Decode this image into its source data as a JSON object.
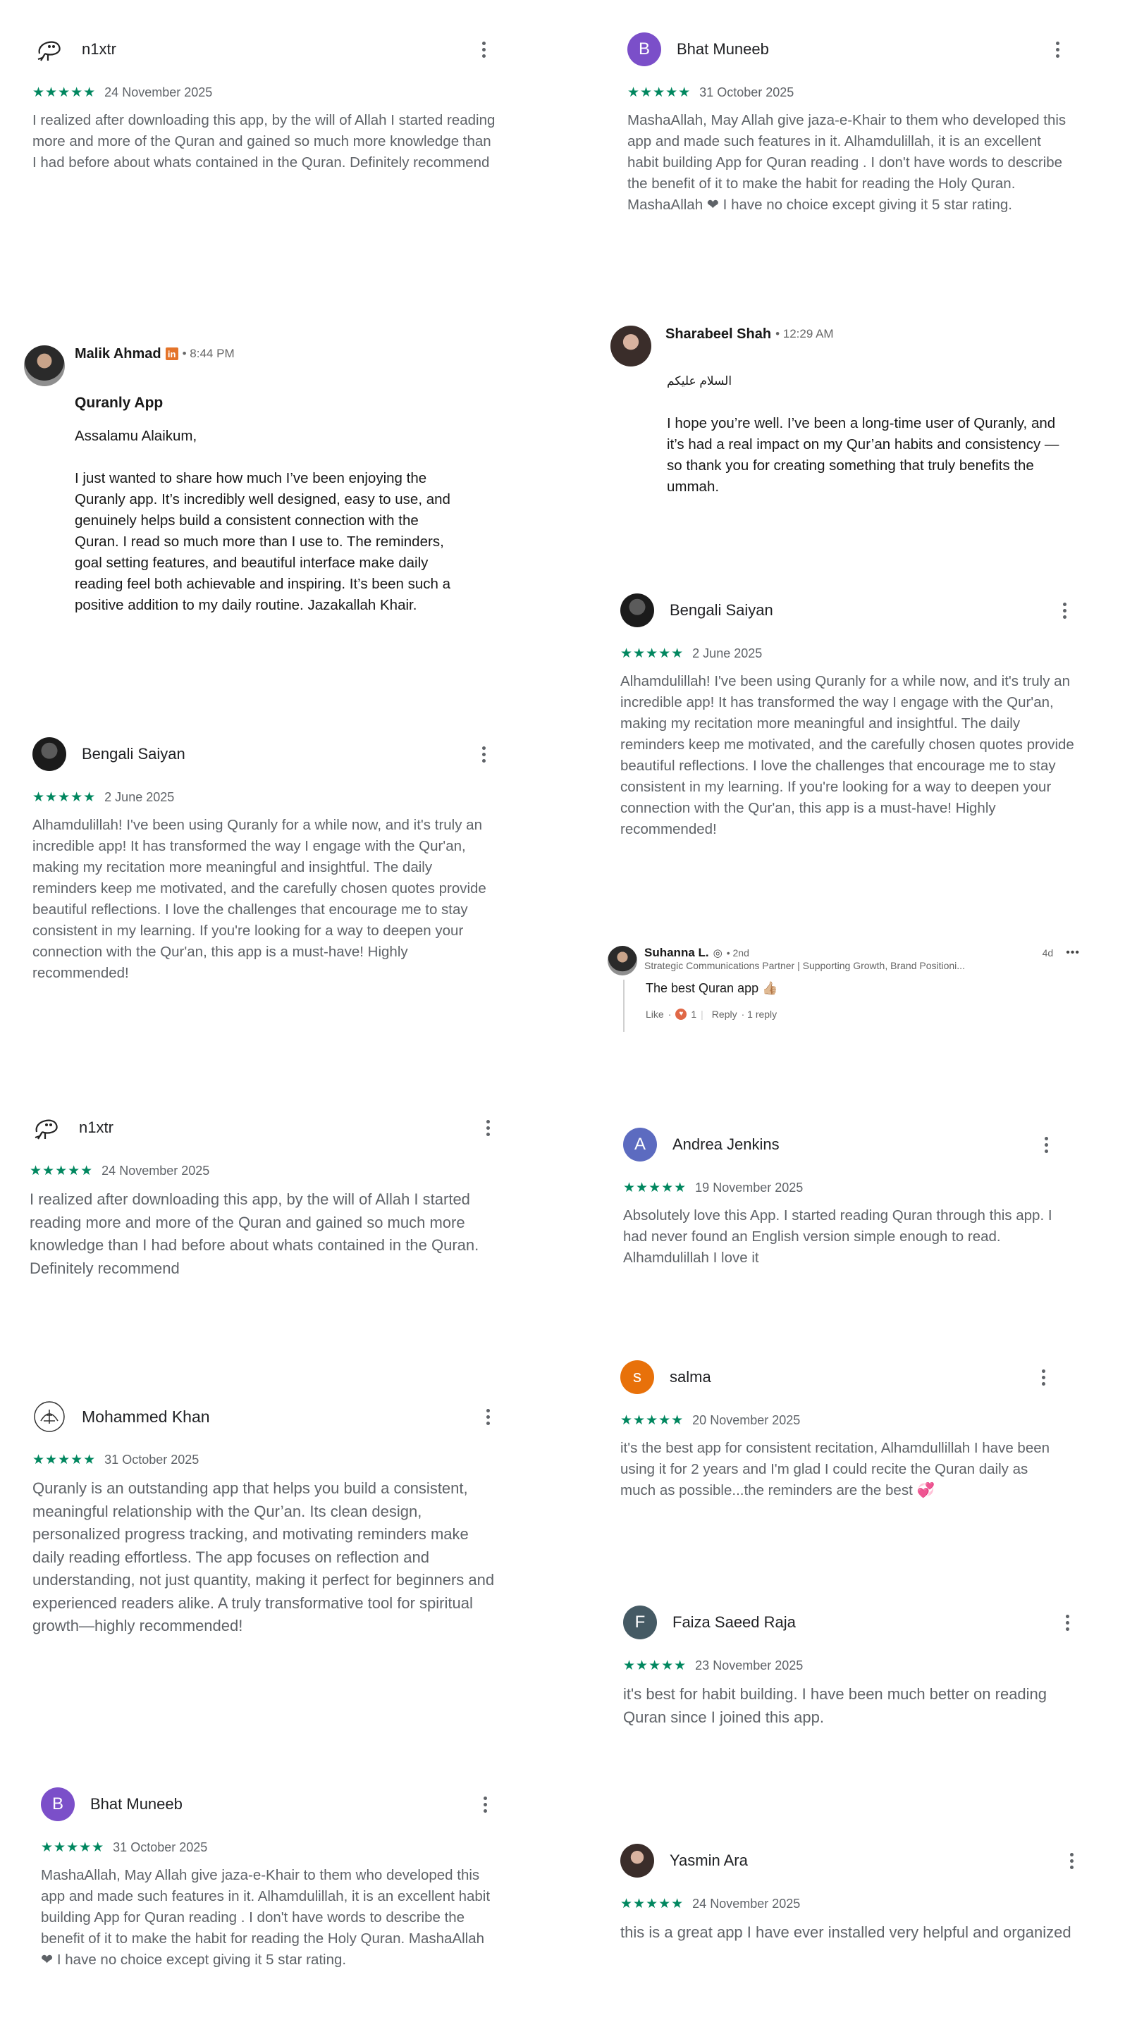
{
  "colors": {
    "star_green": "#01875f",
    "text_gray": "#5f6368"
  },
  "reviews": {
    "r1": {
      "name": "n1xtr",
      "stars": "★★★★★",
      "date": "24 November 2025",
      "text": "I realized after downloading this app, by the will of Allah I started reading more and more of the Quran and gained so much more knowledge than I had before about whats contained in the Quran. Definitely recommend",
      "avatar_icon": "sketch-avatar-icon"
    },
    "r2": {
      "name": "Bhat Muneeb",
      "initial": "B",
      "avatar_color": "#7b4fc9",
      "stars": "★★★★★",
      "date": "31 October 2025",
      "text": "MashaAllah, May Allah give jaza-e-Khair to them who developed this app and made such features in it. Alhamdulillah, it is an excellent habit building App for Quran reading . I don't have words to describe the benefit of it to make the habit for reading the Holy Quran. MashaAllah ❤ I have no choice except giving it 5 star rating."
    },
    "r5": {
      "name": "Bengali Saiyan",
      "stars": "★★★★★",
      "date": "2 June 2025",
      "text": "Alhamdulillah! I've been using Quranly for a while now, and it's truly an incredible app! It has transformed the way I engage with the Qur'an, making my recitation more meaningful and insightful. The daily reminders keep me motivated, and the carefully chosen quotes provide beautiful reflections. I love the challenges that encourage me to stay consistent in my learning. If you're looking for a way to deepen your connection with the Qur'an, this app is a must-have! Highly recommended!"
    },
    "r10": {
      "name": "Andrea Jenkins",
      "initial": "A",
      "avatar_color": "#5c6bc0",
      "stars": "★★★★★",
      "date": "19 November 2025",
      "text": "Absolutely love this App. I started reading Quran through this app. I had never found an English version simple enough to read. Alhamdulillah I love it"
    },
    "r11": {
      "name": "Mohammed Khan",
      "stars": "★★★★★",
      "date": "31 October 2025",
      "text": "Quranly is an outstanding app that helps you build a consistent, meaningful relationship with the Qur’an. Its clean design, personalized progress tracking, and motivating reminders make daily reading effortless. The app focuses on reflection and understanding, not just quantity, making it perfect for beginners and experienced readers alike. A truly transformative tool for spiritual growth—highly recommended!"
    },
    "r12": {
      "name": "salma",
      "initial": "s",
      "avatar_color": "#e8710a",
      "stars": "★★★★★",
      "date": "20 November 2025",
      "text": "it's the best app for consistent recitation, Alhamdullillah I have been using it for 2 years and I'm glad I could recite the Quran daily as much as possible...the reminders are the best 💞"
    },
    "r13": {
      "name": "Faiza Saeed Raja",
      "initial": "F",
      "avatar_color": "#455a64",
      "stars": "★★★★★",
      "date": "23 November 2025",
      "text": "it's best for habit building. I have been much better on reading Quran since I joined this app."
    },
    "r15": {
      "name": "Yasmin Ara",
      "stars": "★★★★★",
      "date": "24 November 2025",
      "text": "this is a great app I have ever installed very helpful and organized"
    }
  },
  "message1": {
    "name": "Malik Ahmad",
    "badge": "in",
    "time": "• 8:44 PM",
    "subject": "Quranly App",
    "greeting": "Assalamu Alaikum,",
    "body": "I just wanted to share how much I’ve been enjoying the Quranly app. It’s incredibly well designed, easy to use, and genuinely helps build a consistent connection with the Quran. I read so much more than I use to. The reminders, goal setting features, and beautiful interface make daily reading feel both achievable and inspiring. It’s been such a positive addition to my daily routine. Jazakallah Khair."
  },
  "message2": {
    "name": "Sharabeel Shah",
    "time": "• 12:29 AM",
    "greeting": "السلام علیکم",
    "body": "I hope you’re well. I’ve been a long-time user of Quranly, and it’s had a real impact on my Qur’an habits and consistency — so thank you for creating something that truly benefits the ummah."
  },
  "comment": {
    "name": "Suhanna L.",
    "degree": "• 2nd",
    "age": "4d",
    "headline": "Strategic Communications Partner | Supporting Growth, Brand Positioni...",
    "text": "The best Quran app 👍🏼",
    "like_label": "Like",
    "like_count": "1",
    "reply_label": "Reply",
    "reply_count": "· 1 reply"
  }
}
